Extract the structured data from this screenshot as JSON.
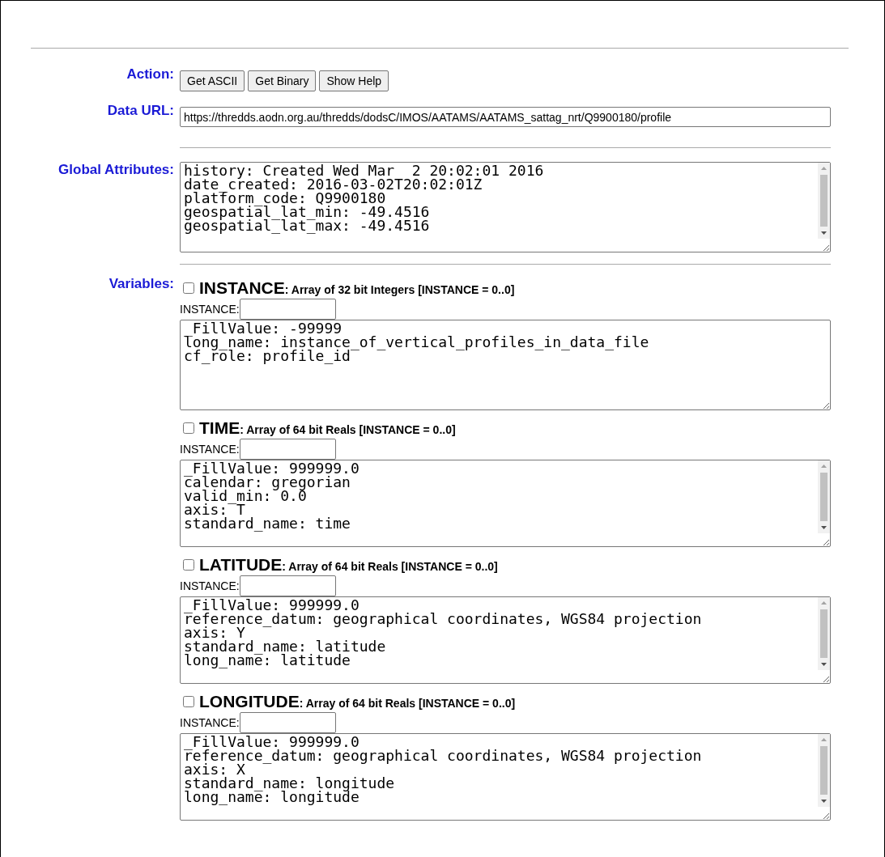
{
  "action": {
    "label": "Action:",
    "buttons": [
      "Get ASCII",
      "Get Binary",
      "Show Help"
    ]
  },
  "data_url": {
    "label": "Data URL:",
    "value": "https://thredds.aodn.org.au/thredds/dodsC/IMOS/AATAMS/AATAMS_sattag_nrt/Q9900180/profile"
  },
  "global_attributes": {
    "label": "Global Attributes:",
    "scrollbar": true,
    "lines": [
      "history: Created Wed Mar  2 20:02:01 2016",
      "date_created: 2016-03-02T20:02:01Z",
      "platform_code: Q9900180",
      "geospatial_lat_min: -49.4516",
      "geospatial_lat_max: -49.4516"
    ]
  },
  "variables": {
    "label": "Variables:",
    "items": [
      {
        "name": "INSTANCE",
        "type": ": Array of 32 bit Integers [INSTANCE = 0..0]",
        "checked": false,
        "dim_label": "INSTANCE:",
        "scrollbar": false,
        "attributes": [
          "_FillValue: -99999",
          "long_name: instance_of_vertical_profiles_in_data_file",
          "cf_role: profile_id"
        ]
      },
      {
        "name": "TIME",
        "type": ": Array of 64 bit Reals [INSTANCE = 0..0]",
        "checked": false,
        "dim_label": "INSTANCE:",
        "scrollbar": true,
        "attributes": [
          "_FillValue: 999999.0",
          "calendar: gregorian",
          "valid_min: 0.0",
          "axis: T",
          "standard_name: time"
        ]
      },
      {
        "name": "LATITUDE",
        "type": ": Array of 64 bit Reals [INSTANCE = 0..0]",
        "checked": false,
        "dim_label": "INSTANCE:",
        "scrollbar": true,
        "attributes": [
          "_FillValue: 999999.0",
          "reference_datum: geographical coordinates, WGS84 projection",
          "axis: Y",
          "standard_name: latitude",
          "long_name: latitude"
        ]
      },
      {
        "name": "LONGITUDE",
        "type": ": Array of 64 bit Reals [INSTANCE = 0..0]",
        "checked": false,
        "dim_label": "INSTANCE:",
        "scrollbar": true,
        "attributes": [
          "_FillValue: 999999.0",
          "reference_datum: geographical coordinates, WGS84 projection",
          "axis: X",
          "standard_name: longitude",
          "long_name: longitude"
        ]
      }
    ]
  }
}
